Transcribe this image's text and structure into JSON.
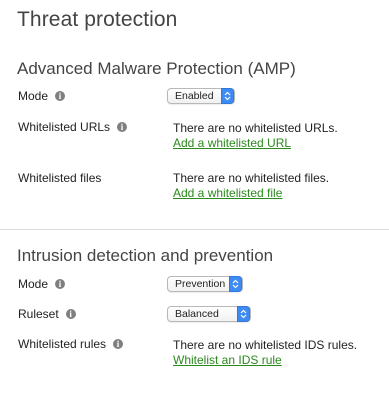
{
  "page": {
    "title": "Threat protection"
  },
  "amp": {
    "title": "Advanced Malware Protection (AMP)",
    "mode": {
      "label": "Mode",
      "value": "Enabled"
    },
    "whitelisted_urls": {
      "label": "Whitelisted URLs",
      "status": "There are no whitelisted URLs.",
      "link": "Add a whitelisted URL"
    },
    "whitelisted_files": {
      "label": "Whitelisted files",
      "status": "There are no whitelisted files.",
      "link": "Add a whitelisted file"
    }
  },
  "ids": {
    "title": "Intrusion detection and prevention",
    "mode": {
      "label": "Mode",
      "value": "Prevention"
    },
    "ruleset": {
      "label": "Ruleset",
      "value": "Balanced"
    },
    "whitelisted_rules": {
      "label": "Whitelisted rules",
      "status": "There are no whitelisted IDS rules.",
      "link": "Whitelist an IDS rule"
    }
  },
  "colors": {
    "link": "#2a8a1c",
    "select_accent": "#3d8bf3",
    "info_icon": "#7f7f7f"
  }
}
